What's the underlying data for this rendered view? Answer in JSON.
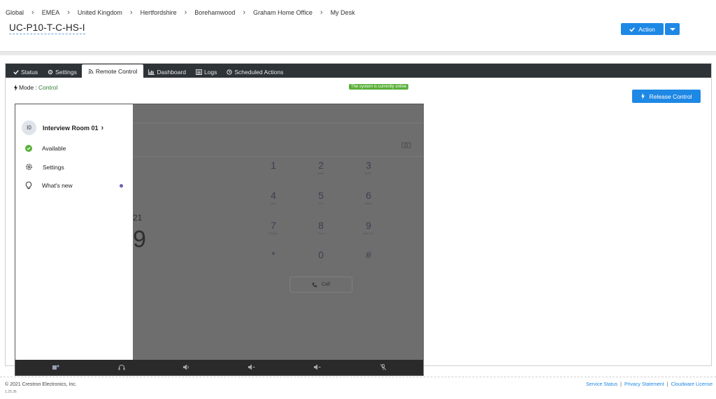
{
  "breadcrumb": [
    "Global",
    "EMEA",
    "United Kingdom",
    "Hertfordshire",
    "Borehamwood",
    "Graham Home Office",
    "My Desk"
  ],
  "page_title": "UC-P10-T-C-HS-I",
  "action_label": "Action",
  "tabs": [
    {
      "label": "Status",
      "icon": "check-icon"
    },
    {
      "label": "Settings",
      "icon": "gear-icon"
    },
    {
      "label": "Remote Control",
      "icon": "rss-icon"
    },
    {
      "label": "Dashboard",
      "icon": "bar-chart-icon"
    },
    {
      "label": "Logs",
      "icon": "list-icon"
    },
    {
      "label": "Scheduled Actions",
      "icon": "clock-icon"
    }
  ],
  "mode_label": "Mode : ",
  "mode_value": "Control",
  "online_badge": "The system is currently online",
  "release_label": "Release Control",
  "device": {
    "room_initials": "I0",
    "room_name": "Interview Room 01",
    "menu": [
      {
        "label": "Available",
        "icon": "check-circle-icon"
      },
      {
        "label": "Settings",
        "icon": "gear-icon"
      },
      {
        "label": "What's new",
        "icon": "lightbulb-icon"
      }
    ],
    "partial_small": "21",
    "partial_big": "9",
    "keys": [
      {
        "d": "1",
        "l": ""
      },
      {
        "d": "2",
        "l": "ABC"
      },
      {
        "d": "3",
        "l": "DEF"
      },
      {
        "d": "4",
        "l": "GHI"
      },
      {
        "d": "5",
        "l": "JKL"
      },
      {
        "d": "6",
        "l": "MNO"
      },
      {
        "d": "7",
        "l": "PQRS"
      },
      {
        "d": "8",
        "l": "TUV"
      },
      {
        "d": "9",
        "l": "WXYZ"
      },
      {
        "d": "*",
        "l": ""
      },
      {
        "d": "0",
        "l": "+"
      },
      {
        "d": "#",
        "l": ""
      }
    ],
    "call_label": "Call"
  },
  "footer": {
    "copyright": "© 2021 Crestron Electronics, Inc.",
    "version": "1.25.36",
    "links": [
      "Service Status",
      "Privacy Statement",
      "Cloudware License"
    ]
  }
}
